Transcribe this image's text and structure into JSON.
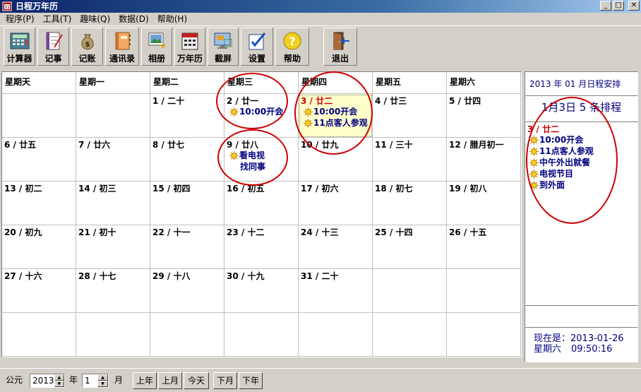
{
  "window": {
    "title": "日程万年历"
  },
  "menu": [
    {
      "label": "程序(P)"
    },
    {
      "label": "工具(T)"
    },
    {
      "label": "趣味(Q)"
    },
    {
      "label": "数据(D)"
    },
    {
      "label": "帮助(H)"
    }
  ],
  "toolbar": [
    {
      "label": "计算器",
      "icon": "calculator-icon"
    },
    {
      "label": "记事",
      "icon": "notepad-icon"
    },
    {
      "label": "记账",
      "icon": "moneybag-icon"
    },
    {
      "label": "通讯录",
      "icon": "addressbook-icon"
    },
    {
      "label": "相册",
      "icon": "photo-album-icon"
    },
    {
      "label": "万年历",
      "icon": "calendar-icon"
    },
    {
      "label": "截屏",
      "icon": "screenshot-icon"
    },
    {
      "label": "设置",
      "icon": "settings-icon"
    },
    {
      "label": "帮助",
      "icon": "help-icon"
    },
    {
      "label": "退出",
      "icon": "exit-door-icon"
    }
  ],
  "calendar": {
    "weekdays": [
      "星期天",
      "星期一",
      "星期二",
      "星期三",
      "星期四",
      "星期五",
      "星期六"
    ],
    "weeks": [
      [
        null,
        null,
        {
          "date": "1 / 二十"
        },
        {
          "date": "2 / 廿一",
          "events": [
            "10:00开会"
          ]
        },
        {
          "date": "3 / 廿二",
          "today": true,
          "events": [
            "10:00开会",
            "11点客人参观"
          ]
        },
        {
          "date": "4 / 廿三"
        },
        {
          "date": "5 / 廿四"
        }
      ],
      [
        {
          "date": "6 / 廿五"
        },
        {
          "date": "7 / 廿六"
        },
        {
          "date": "8 / 廿七"
        },
        {
          "date": "9 / 廿八",
          "events": [
            "看电视",
            "找同事"
          ]
        },
        {
          "date": "10 / 廿九"
        },
        {
          "date": "11 / 三十"
        },
        {
          "date": "12 / 腊月初一"
        }
      ],
      [
        {
          "date": "13 / 初二"
        },
        {
          "date": "14 / 初三"
        },
        {
          "date": "15 / 初四"
        },
        {
          "date": "16 / 初五"
        },
        {
          "date": "17 / 初六"
        },
        {
          "date": "18 / 初七"
        },
        {
          "date": "19 / 初八"
        }
      ],
      [
        {
          "date": "20 / 初九"
        },
        {
          "date": "21 / 初十"
        },
        {
          "date": "22 / 十一"
        },
        {
          "date": "23 / 十二"
        },
        {
          "date": "24 / 十三"
        },
        {
          "date": "25 / 十四"
        },
        {
          "date": "26 / 十五"
        }
      ],
      [
        {
          "date": "27 / 十六"
        },
        {
          "date": "28 / 十七"
        },
        {
          "date": "29 / 十八"
        },
        {
          "date": "30 / 十九"
        },
        {
          "date": "31 / 二十"
        },
        null,
        null
      ],
      [
        null,
        null,
        null,
        null,
        null,
        null,
        null
      ]
    ]
  },
  "side": {
    "month_header": "2013 年 01 月日程安排",
    "day_count": "1月3日 5 条排程",
    "selected_date": "3 / 廿二",
    "events": [
      "10:00开会",
      "11点客人参观",
      "中午外出就餐",
      "电视节目",
      "到外面"
    ],
    "now_label": "现在是：",
    "now_date": "2013-01-26",
    "now_weekday": "星期六",
    "now_time": "09:50:16"
  },
  "bottom": {
    "era_label": "公元",
    "year_value": "2013",
    "year_unit": "年",
    "month_value": "1",
    "month_unit": "月",
    "buttons": [
      "上年",
      "上月",
      "今天",
      "下月",
      "下年"
    ]
  },
  "colors": {
    "event_text": "#000080",
    "today_date": "#d00000",
    "today_bg": "#ffffcc",
    "annotation": "#cc0000"
  }
}
